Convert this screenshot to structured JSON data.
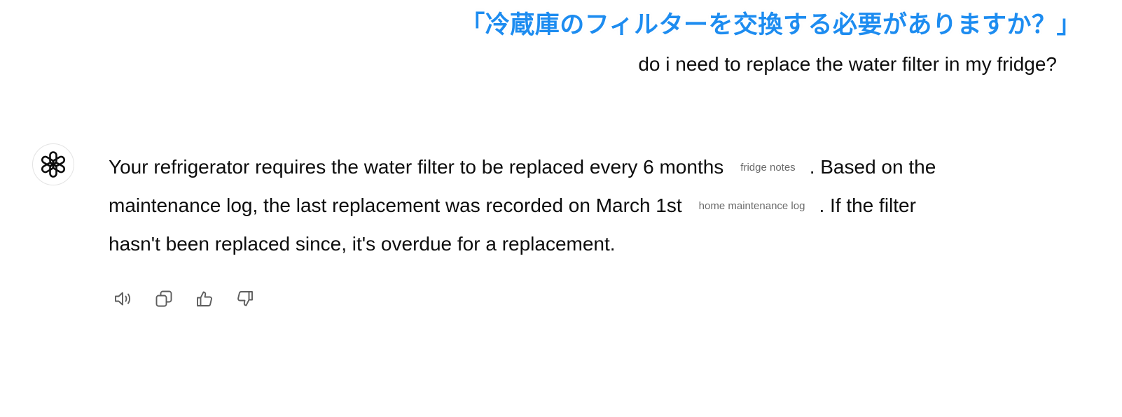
{
  "caption": {
    "text": "「冷蔵庫のフィルターを交換する必要がありますか？」",
    "color": "#1d8cf0"
  },
  "user_message": {
    "text": "do i need to replace the water filter in my fridge?"
  },
  "assistant": {
    "avatar_icon": "openai-logo-icon",
    "response": {
      "segment_1": "Your refrigerator requires the water filter to be replaced every 6 months",
      "citation_1": "fridge notes",
      "segment_2": ". Based on the",
      "segment_3": "maintenance log, the last replacement was recorded on March 1st",
      "citation_2": "home maintenance log",
      "segment_4": ". If the filter",
      "segment_5": "hasn't been replaced since, it's overdue for a replacement."
    },
    "actions": [
      {
        "icon": "speaker-icon"
      },
      {
        "icon": "copy-icon"
      },
      {
        "icon": "thumbs-up-icon"
      },
      {
        "icon": "thumbs-down-icon"
      }
    ]
  }
}
